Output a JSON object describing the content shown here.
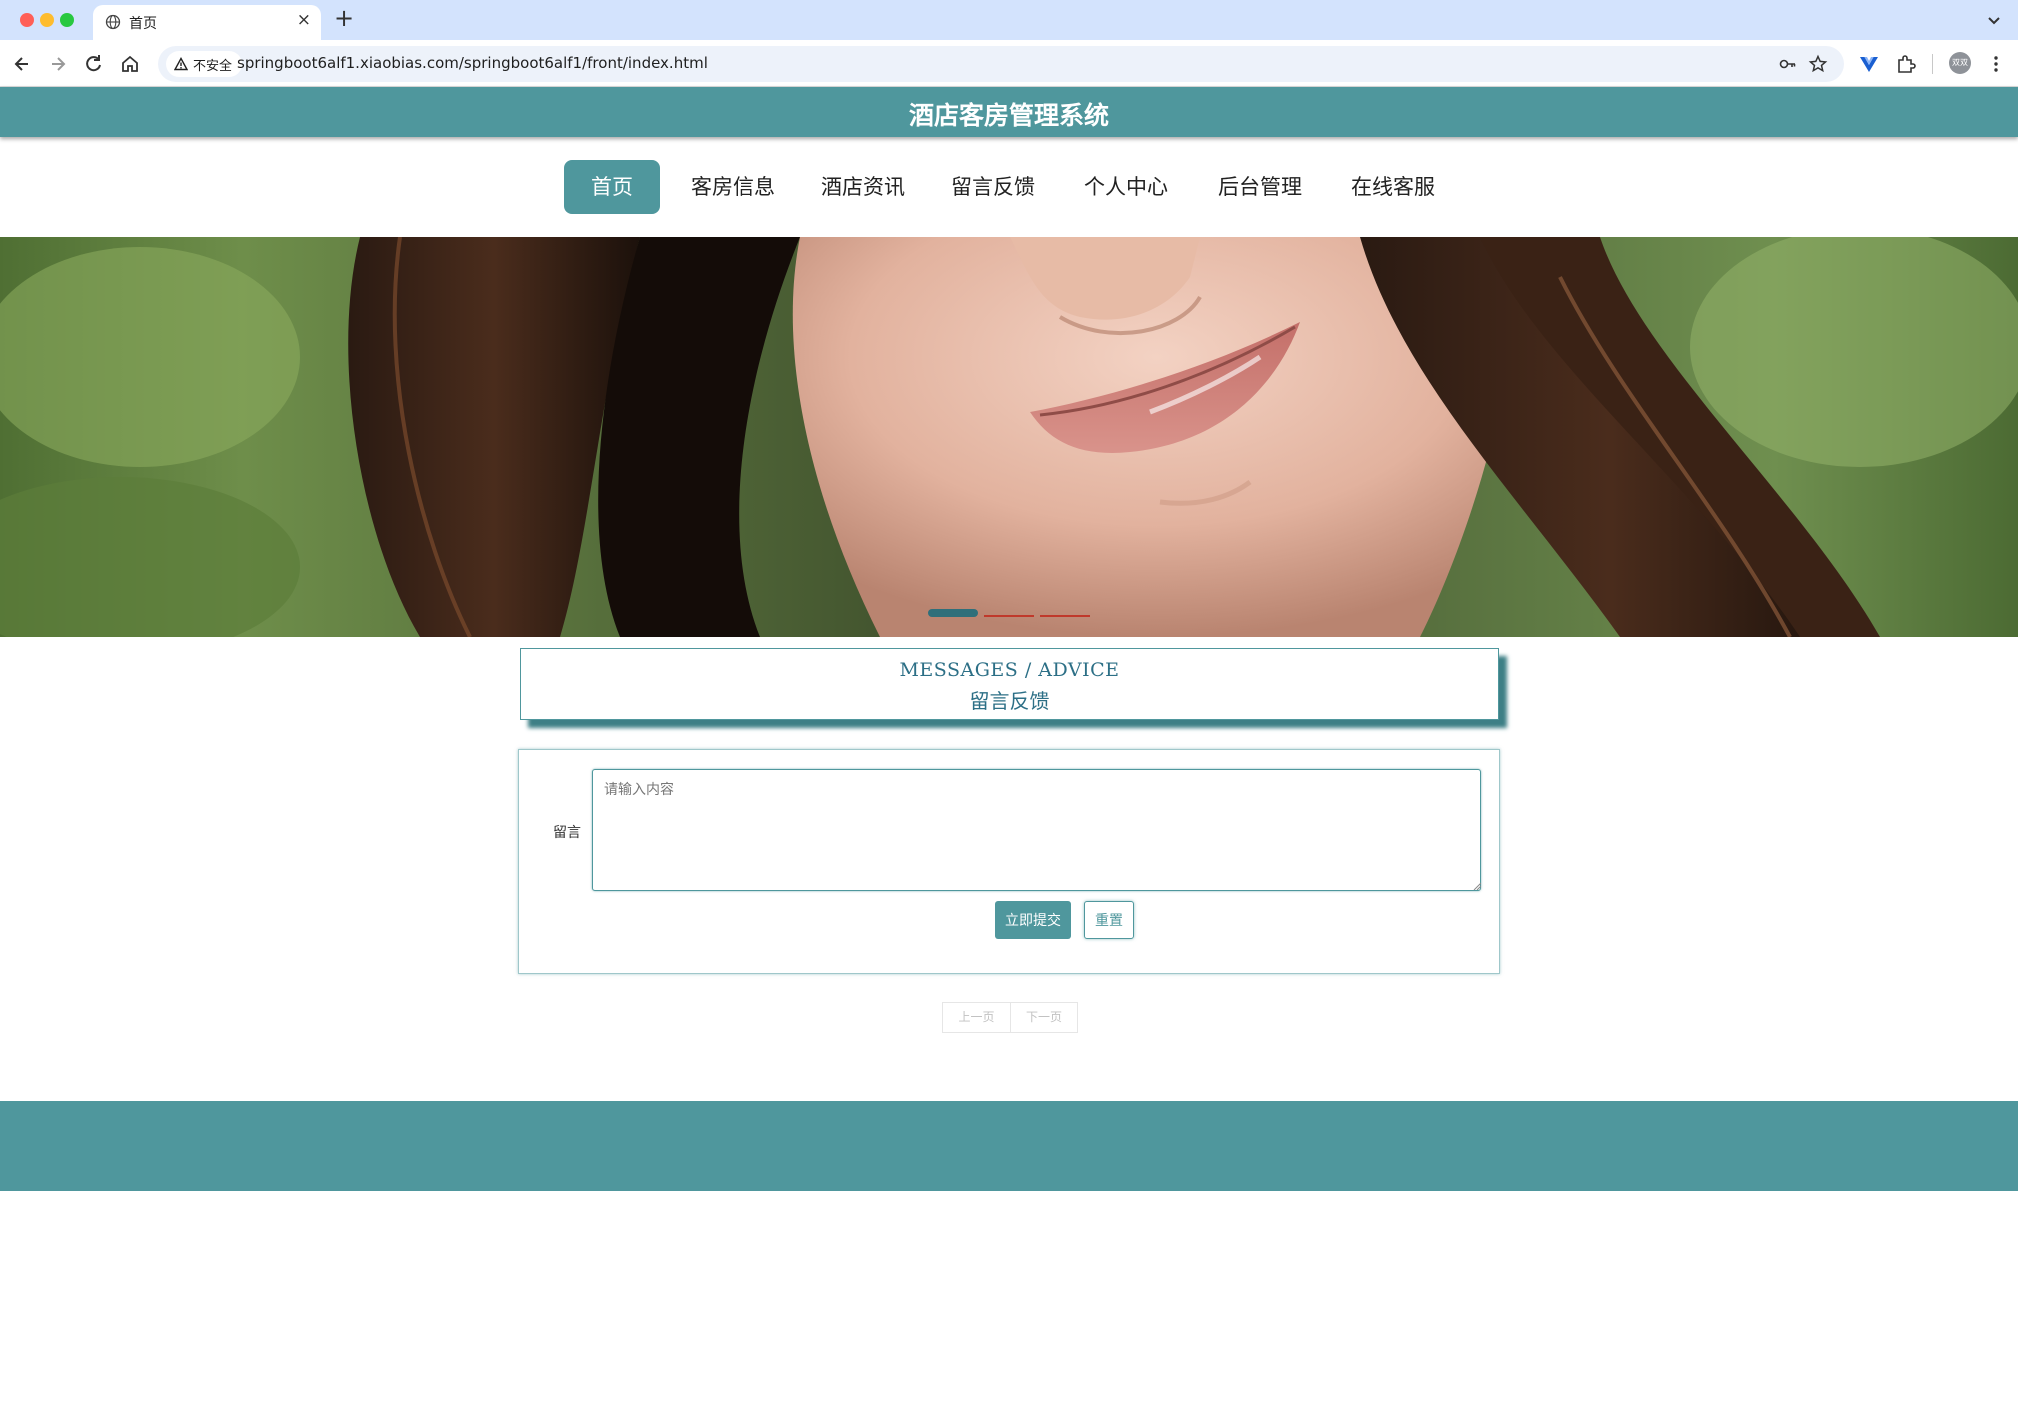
{
  "browser": {
    "tab_title": "首页",
    "new_tab": "+",
    "security_label": "不安全",
    "url": "springboot6alf1.xiaobias.com/springboot6alf1/front/index.html",
    "profile_initials": "双双"
  },
  "site": {
    "title": "酒店客房管理系统"
  },
  "nav": {
    "items": [
      {
        "label": "首页",
        "active": true
      },
      {
        "label": "客房信息",
        "active": false
      },
      {
        "label": "酒店资讯",
        "active": false
      },
      {
        "label": "留言反馈",
        "active": false
      },
      {
        "label": "个人中心",
        "active": false
      },
      {
        "label": "后台管理",
        "active": false
      },
      {
        "label": "在线客服",
        "active": false
      }
    ]
  },
  "carousel": {
    "slide_count": 3,
    "active_index": 0
  },
  "section": {
    "title_en": "MESSAGES / ADVICE",
    "title_cn": "留言反馈"
  },
  "form": {
    "label": "留言",
    "placeholder": "请输入内容",
    "value": "",
    "submit_label": "立即提交",
    "reset_label": "重置"
  },
  "pagination": {
    "prev_label": "上一页",
    "next_label": "下一页"
  },
  "colors": {
    "theme": "#4f979d",
    "title_text": "#2c6f86",
    "carousel_active": "#2f6f7a",
    "carousel_inactive": "#c0392b"
  }
}
